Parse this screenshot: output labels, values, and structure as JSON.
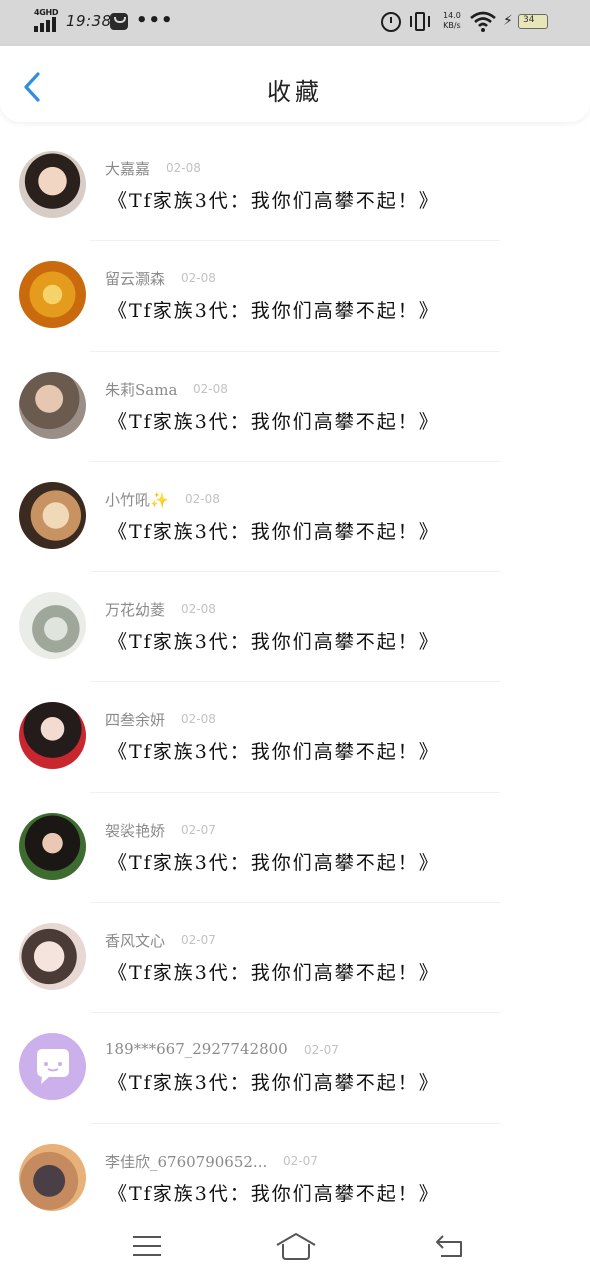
{
  "status_bar": {
    "network": "4GHD",
    "time": "19:38",
    "overflow": "•••",
    "speed_value": "14.0",
    "speed_unit": "KB/s",
    "battery": "34",
    "icons": [
      "signal-icon",
      "message-icon",
      "alarm-icon",
      "vibrate-icon",
      "wifi-icon",
      "charging-icon",
      "battery-icon"
    ]
  },
  "header": {
    "title": "收藏",
    "back_icon": "chevron-left-icon",
    "accent_color": "#2f8ee0"
  },
  "items": [
    {
      "name": "大嘉嘉",
      "date": "02-08",
      "title": "《Tf家族3代：我你们高攀不起！》",
      "avatar": "photo"
    },
    {
      "name": "留云灏森",
      "date": "02-08",
      "title": "《Tf家族3代：我你们高攀不起！》",
      "avatar": "photo"
    },
    {
      "name": "朱莉Sama",
      "date": "02-08",
      "title": "《Tf家族3代：我你们高攀不起！》",
      "avatar": "photo"
    },
    {
      "name": "小竹吼✨",
      "date": "02-08",
      "title": "《Tf家族3代：我你们高攀不起！》",
      "avatar": "photo"
    },
    {
      "name": "万花幼菱",
      "date": "02-08",
      "title": "《Tf家族3代：我你们高攀不起！》",
      "avatar": "photo"
    },
    {
      "name": "四叁余妍",
      "date": "02-08",
      "title": "《Tf家族3代：我你们高攀不起！》",
      "avatar": "photo"
    },
    {
      "name": "袈裟艳娇",
      "date": "02-07",
      "title": "《Tf家族3代：我你们高攀不起！》",
      "avatar": "photo"
    },
    {
      "name": "香风文心",
      "date": "02-07",
      "title": "《Tf家族3代：我你们高攀不起！》",
      "avatar": "photo"
    },
    {
      "name": "189***667_2927742800",
      "date": "02-07",
      "title": "《Tf家族3代：我你们高攀不起！》",
      "avatar": "chat-bubble-icon"
    },
    {
      "name": "李佳欣_6760790652...",
      "date": "02-07",
      "title": "《Tf家族3代：我你们高攀不起！》",
      "avatar": "photo"
    }
  ],
  "bottom_nav": {
    "icons": [
      "menu-icon",
      "home-icon",
      "return-icon"
    ]
  }
}
